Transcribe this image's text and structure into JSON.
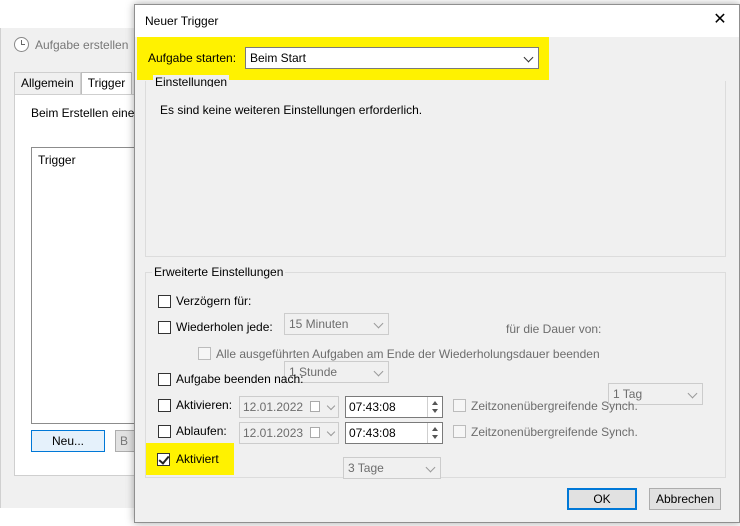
{
  "background_window": {
    "title": "Aufgabe erstellen",
    "tabs": [
      {
        "label": "Allgemein"
      },
      {
        "label": "Trigger"
      }
    ],
    "description": "Beim Erstellen einer",
    "list_header": "Trigger",
    "new_button": "Neu...",
    "partial_button": "B"
  },
  "dialog": {
    "title": "Neuer Trigger",
    "close_glyph": "✕",
    "start_task": {
      "label": "Aufgabe starten:",
      "value": "Beim Start"
    },
    "settings_group": {
      "title": "Einstellungen",
      "message": "Es sind keine weiteren Einstellungen erforderlich."
    },
    "advanced": {
      "title": "Erweiterte Einstellungen",
      "delay": {
        "label": "Verzögern für:",
        "value": "15 Minuten",
        "checked": false
      },
      "repeat": {
        "label": "Wiederholen jede:",
        "value": "1 Stunde",
        "checked": false
      },
      "duration": {
        "label": "für die Dauer von:",
        "value": "1 Tag"
      },
      "stop_all": {
        "label": "Alle ausgeführten Aufgaben am Ende der Wiederholungsdauer beenden",
        "checked": false
      },
      "stop_after": {
        "label": "Aufgabe beenden nach:",
        "value": "3 Tage",
        "checked": false
      },
      "activate": {
        "label": "Aktivieren:",
        "date": "12.01.2022",
        "time": "07:43:08",
        "checked": false
      },
      "expire": {
        "label": "Ablaufen:",
        "date": "12.01.2023",
        "time": "07:43:08",
        "checked": false
      },
      "sync_label": "Zeitzonenübergreifende Synch.",
      "enabled": {
        "label": "Aktiviert",
        "checked": true
      }
    },
    "ok_button": "OK",
    "cancel_button": "Abbrechen"
  },
  "colors": {
    "highlight": "#fff200",
    "accent": "#0078d7"
  }
}
